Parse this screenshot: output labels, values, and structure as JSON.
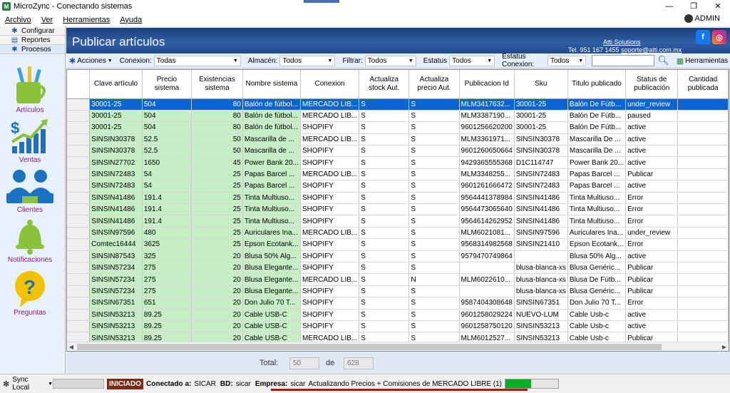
{
  "window": {
    "title": "MicroZync - Conectando sistemas",
    "minimize": "—",
    "maximize": "❐",
    "close": "✕"
  },
  "menu": {
    "items": [
      "Archivo",
      "Ver",
      "Herramientas",
      "Ayuda"
    ],
    "user": "ADMIN"
  },
  "sidebar": {
    "tabs": [
      "Configurar",
      "Reportes",
      "Procesos"
    ],
    "items": [
      "Artículos",
      "Ventas",
      "Clientes",
      "Notificaciones",
      "Preguntas"
    ]
  },
  "header": {
    "title": "Publicar artículos",
    "company": "Atti Solutions",
    "phone": "Tel. 951 167 1455",
    "email": "soporte@atti.com.mx"
  },
  "toolbar": {
    "acciones": "Acciones",
    "conexion_label": "Conexion:",
    "conexion_value": "Todas",
    "almacen_label": "Almacén:",
    "almacen_value": "Todos",
    "filtrar_label": "Filtrar:",
    "filtrar_value": "Todos",
    "estatus_label": "Estatus",
    "estatus_value": "Todos",
    "estatus_conexion_label": "Estatus Conexion:",
    "estatus_conexion_value": "Todos",
    "search_value": "",
    "herramientas": "Herramientas"
  },
  "grid": {
    "columns": [
      "Clave artículo",
      "Precio sistema",
      "Existencias sistema",
      "Nombre sistema",
      "Conexion",
      "Actualiza stock Aut.",
      "Actualiza precio Aut.",
      "Publicacion Id",
      "Sku",
      "Titulo publicado",
      "Status de publicación",
      "Cantidad publicada"
    ],
    "rows": [
      [
        "30001-25",
        "504",
        "80",
        "Balón de fútbol...",
        "MERCADO LIB...",
        "S",
        "S",
        "MLM3417632...",
        "30001-25",
        "Balón De Fútb...",
        "under_review",
        ""
      ],
      [
        "30001-25",
        "504",
        "80",
        "Balón de fútbol...",
        "MERCADO LIB...",
        "S",
        "S",
        "MLM3387190...",
        "30001-25",
        "Balón De Fútb...",
        "paused",
        ""
      ],
      [
        "30001-25",
        "504",
        "80",
        "Balón de fútbol...",
        "SHOPIFY",
        "S",
        "S",
        "9601256620200",
        "30001-25",
        "Balón De Fútb...",
        "active",
        ""
      ],
      [
        "SINSIN30378",
        "52.5",
        "50",
        "Mascarilla de ...",
        "MERCADO LIB...",
        "S",
        "S",
        "MLM3361971...",
        "SINSIN30378",
        "Mascarilla De ...",
        "active",
        ""
      ],
      [
        "SINSIN30378",
        "52.5",
        "50",
        "Mascarilla de ...",
        "SHOPIFY",
        "S",
        "S",
        "9601260650664",
        "SINSIN30378",
        "Mascarilla De ...",
        "active",
        ""
      ],
      [
        "SINSIN27702",
        "1650",
        "45",
        "Power Bank 20...",
        "SHOPIFY",
        "S",
        "S",
        "9429365555368",
        "D1C114747",
        "Power Bank 20...",
        "active",
        ""
      ],
      [
        "SINSIN72483",
        "54",
        "25",
        "Papas Barcel ...",
        "MERCADO LIB...",
        "S",
        "S",
        "MLM3348255...",
        "SINSIN72483",
        "Papas Barcel ...",
        "Publicar",
        ""
      ],
      [
        "SINSIN72483",
        "54",
        "25",
        "Papas Barcel ...",
        "SHOPIFY",
        "S",
        "S",
        "9601261666472",
        "SINSIN72483",
        "Papas Barcel ...",
        "active",
        ""
      ],
      [
        "SINSIN41486",
        "191.4",
        "25",
        "Tinta Multiuso...",
        "SHOPIFY",
        "S",
        "S",
        "9564441378984",
        "SINSIN41486",
        "Tinta Multiuso...",
        "Error",
        ""
      ],
      [
        "SINSIN41486",
        "191.4",
        "25",
        "Tinta Multiuso...",
        "SHOPIFY",
        "S",
        "S",
        "9564473065640",
        "SINSIN41486",
        "Tinta Multiuso...",
        "Error",
        ""
      ],
      [
        "SINSIN41486",
        "191.4",
        "25",
        "Tinta Multiuso...",
        "SHOPIFY",
        "S",
        "S",
        "9564614262952",
        "SINSIN41486",
        "Tinta Multiuso...",
        "Error",
        ""
      ],
      [
        "SINSIN97596",
        "480",
        "25",
        "Auriculares Ina...",
        "MERCADO LIB...",
        "S",
        "S",
        "MLM6021081...",
        "SINSIN97596",
        "Auriculares Ina...",
        "under_review",
        ""
      ],
      [
        "Comtec16444",
        "3625",
        "25",
        "Epson Ecotank...",
        "SHOPIFY",
        "S",
        "S",
        "9568314982568",
        "SINSIN21410",
        "Epson Ecotank...",
        "Error",
        ""
      ],
      [
        "SINSIN87543",
        "325",
        "20",
        "Blusa 50% Alg...",
        "SHOPIFY",
        "S",
        "S",
        "9579470749864",
        "",
        "Blusa 50% Alg...",
        "active",
        ""
      ],
      [
        "SINSIN57234",
        "275",
        "20",
        "Blusa Elegante...",
        "SHOPIFY",
        "S",
        "S",
        "",
        "blusa-blanca-xs",
        "Blusa Genéric...",
        "Publicar",
        ""
      ],
      [
        "SINSIN57234",
        "275",
        "20",
        "Blusa Elegante...",
        "MERCADO LIB...",
        "S",
        "N",
        "MLM6022610...",
        "blusa-blanca-xs",
        "Blusa De Fútb...",
        "Publicar",
        ""
      ],
      [
        "SINSIN57234",
        "275",
        "20",
        "Blusa Elegante...",
        "SHOPIFY",
        "S",
        "S",
        "",
        "blusa-blanca-xs",
        "Blusa Genéric...",
        "Publicar",
        ""
      ],
      [
        "SINSIN67351",
        "651",
        "20",
        "Don Julio 70 T...",
        "SHOPIFY",
        "S",
        "S",
        "9587404308648",
        "SINSIN67351",
        "Don Julio 70 T...",
        "Error",
        ""
      ],
      [
        "SINSIN53213",
        "89.25",
        "20",
        "Cable USB-C",
        "SHOPIFY",
        "S",
        "S",
        "9601258029224",
        "NUEVO-LUM",
        "Cable Usb-c",
        "active",
        ""
      ],
      [
        "SINSIN53213",
        "89.25",
        "20",
        "Cable USB-C",
        "SHOPIFY",
        "S",
        "S",
        "9601258750120",
        "SINSIN53213",
        "Cable Usb-c",
        "active",
        ""
      ],
      [
        "SINSIN53213",
        "89.25",
        "20",
        "Cable USB-C",
        "MERCADO LIB...",
        "S",
        "S",
        "MLM6012527...",
        "SINSIN53213",
        "Cable Usb-c",
        "Publicar",
        ""
      ]
    ]
  },
  "totals": {
    "label": "Total:",
    "shown": "50",
    "de": "de",
    "total": "628"
  },
  "status": {
    "sync": "Sync Local",
    "state": "INICIADO",
    "conectado_label": "Conectado a:",
    "conectado_value": "SICAR",
    "bd_label": "BD:",
    "bd_value": "sicar",
    "empresa_label": "Empresa:",
    "empresa_value": "sicar",
    "message": "Actualizando Precios + Comisiones de MERCADO LIBRE (1)",
    "progress": 0.48
  }
}
